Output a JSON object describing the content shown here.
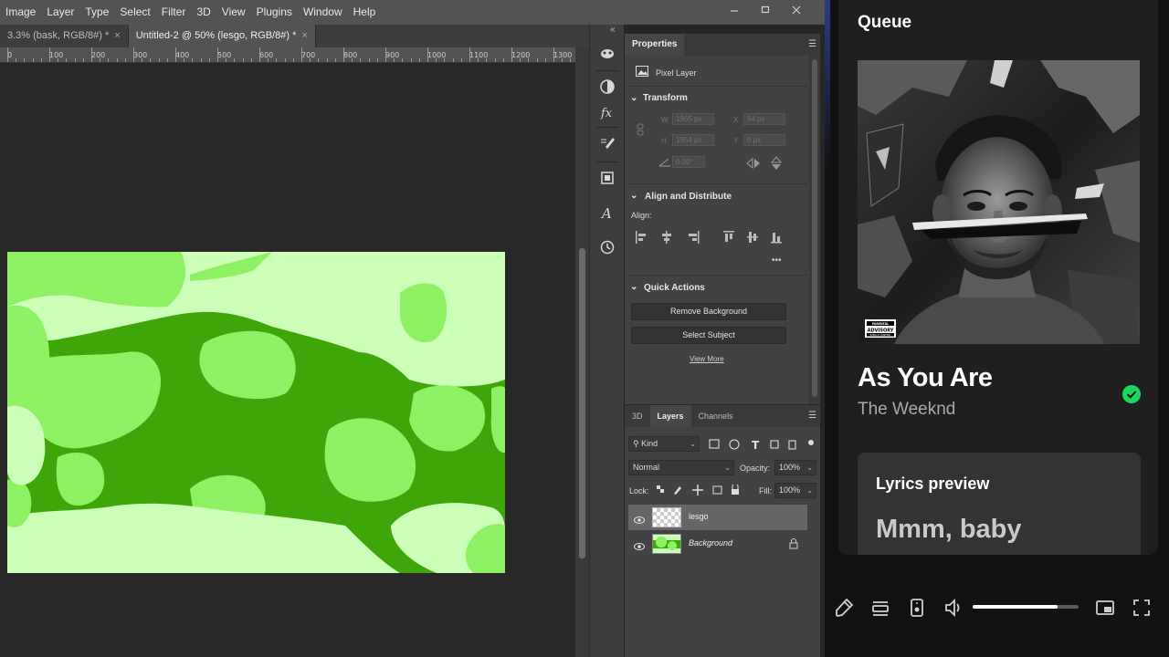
{
  "photoshop": {
    "menu": [
      "Image",
      "Layer",
      "Type",
      "Select",
      "Filter",
      "3D",
      "View",
      "Plugins",
      "Window",
      "Help"
    ],
    "window_controls": [
      "minimize-icon",
      "maximize-icon",
      "close-icon"
    ],
    "tabs": [
      {
        "label": "3.3% (bask, RGB/8#) *",
        "close": "×"
      },
      {
        "label": "Untitled-2 @ 50% (lesgo, RGB/8#) *",
        "close": "×"
      }
    ],
    "ruler_ticks": [
      "0",
      "100",
      "200",
      "300",
      "400",
      "500",
      "600",
      "700",
      "800",
      "900",
      "1000",
      "1100",
      "1200",
      "1300"
    ],
    "tools": [
      "3d-icon",
      "adjustments-icon",
      "fx-icon",
      "brush-settings-icon",
      "clone-source-icon",
      "character-icon",
      "history-icon"
    ],
    "properties": {
      "tab": "Properties",
      "kind": "Pixel Layer",
      "transform_title": "Transform",
      "w_label": "W",
      "w_value": "1965 px",
      "h_label": "H",
      "h_value": "1954 px",
      "x_label": "X",
      "x_value": "94 px",
      "y_label": "Y",
      "y_value": "0 px",
      "angle_value": "0.00°",
      "align_title": "Align and Distribute",
      "align_label": "Align:",
      "more": "•••",
      "quick_title": "Quick Actions",
      "remove_bg": "Remove Background",
      "select_subject": "Select Subject",
      "view_more": "View More"
    },
    "layers": {
      "tabs": [
        "3D",
        "Layers",
        "Channels"
      ],
      "filter_kind": "Kind",
      "blend_mode": "Normal",
      "opacity_label": "Opacity:",
      "opacity_value": "100%",
      "lock_label": "Lock:",
      "fill_label": "Fill:",
      "fill_value": "100%",
      "items": [
        {
          "name": "lesgo",
          "selected": true
        },
        {
          "name": "Background",
          "selected": false
        }
      ]
    }
  },
  "music": {
    "queue_title": "Queue",
    "track_title": "As You Are",
    "artist": "The Weeknd",
    "saved": true,
    "lyrics_title": "Lyrics preview",
    "lyrics_line": "Mmm, baby",
    "advisory_top": "PARENTAL",
    "advisory_main": "ADVISORY",
    "advisory_bottom": "EXPLICIT CONTENT",
    "volume": 0.8,
    "accent": "#1ed760"
  }
}
